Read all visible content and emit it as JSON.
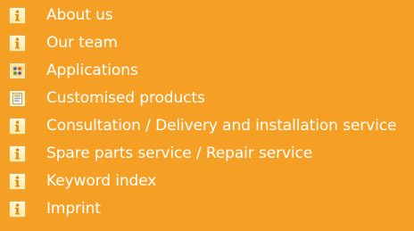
{
  "menu": {
    "items": [
      {
        "label": "About us",
        "icon": "info-icon"
      },
      {
        "label": "Our team",
        "icon": "info-icon"
      },
      {
        "label": "Applications",
        "icon": "applications-icon"
      },
      {
        "label": "Customised products",
        "icon": "document-icon"
      },
      {
        "label": "Consultation / Delivery and installation service",
        "icon": "info-icon"
      },
      {
        "label": "Spare parts service / Repair service",
        "icon": "info-icon"
      },
      {
        "label": "Keyword index",
        "icon": "info-icon"
      },
      {
        "label": "Imprint",
        "icon": "info-icon"
      }
    ]
  },
  "colors": {
    "background": "#f5a024",
    "text": "#ffffff",
    "icon_accent": "#e58a00"
  }
}
